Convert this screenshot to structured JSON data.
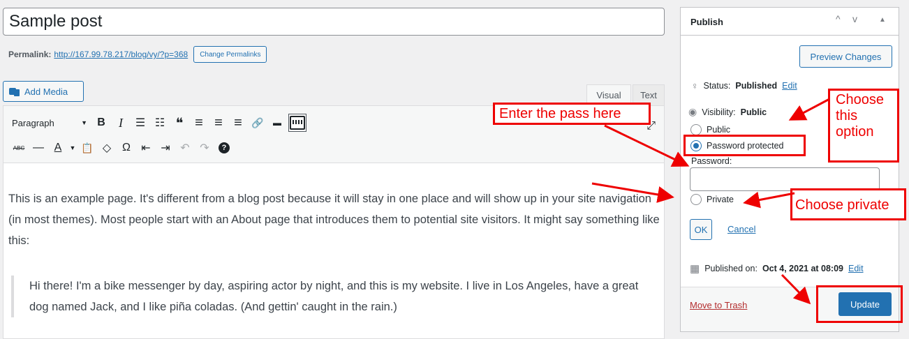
{
  "editor": {
    "title_value": "Sample post",
    "permalink_label": "Permalink:",
    "permalink_url": "http://167.99.78.217/blog/vy/?p=368",
    "change_permalinks_label": "Change Permalinks",
    "add_media_label": "Add Media",
    "tab_visual": "Visual",
    "tab_text": "Text",
    "format_select": "Paragraph",
    "content_paragraph": "This is an example page. It's different from a blog post because it will stay in one place and will show up in your site navigation (in most themes). Most people start with an About page that introduces them to potential site visitors. It might say something like this:",
    "content_quote": "Hi there! I'm a bike messenger by day, aspiring actor by night, and this is my website. I live in Los Angeles, have a great dog named Jack, and I like piña coladas. (And gettin' caught in the rain.)",
    "toolbar_row1_icons": [
      "bold-icon",
      "italic-icon",
      "bulleted-list-icon",
      "numbered-list-icon",
      "blockquote-icon",
      "align-left-icon",
      "align-center-icon",
      "align-right-icon",
      "link-icon",
      "read-more-icon",
      "toolbar-toggle-icon"
    ],
    "toolbar_row2_icons": [
      "strikethrough-icon",
      "horizontal-line-icon",
      "text-color-icon",
      "paste-text-icon",
      "clear-formatting-icon",
      "special-character-icon",
      "outdent-icon",
      "indent-icon",
      "undo-icon",
      "redo-icon",
      "help-icon"
    ],
    "glyphs": {
      "bold": "B",
      "italic": "I",
      "bullets": "☰",
      "numbers": "☷",
      "quote": "❝",
      "align_left": "≡",
      "align_center": "≡",
      "align_right": "≡",
      "link": "🔗",
      "more": "▬",
      "strike": "ABC",
      "hr": "—",
      "text_color": "A",
      "paste": "📋",
      "clear": "◇",
      "omega": "Ω",
      "outdent": "⇤",
      "indent": "⇥",
      "undo": "↶",
      "redo": "↷",
      "help": "?"
    }
  },
  "publish": {
    "title": "Publish",
    "header_controls": [
      "^",
      "v",
      "▲"
    ],
    "preview_label": "Preview Changes",
    "status_label": "Status:",
    "status_value": "Published",
    "edit_label": "Edit",
    "visibility_label": "Visibility:",
    "visibility_value": "Public",
    "options": [
      {
        "label": "Public",
        "checked": false
      },
      {
        "label": "Password protected",
        "checked": true
      },
      {
        "label": "Private",
        "checked": false
      }
    ],
    "password_label": "Password:",
    "ok_label": "OK",
    "cancel_label": "Cancel",
    "published_on_label": "Published on:",
    "published_on_value": "Oct 4, 2021 at 08:09",
    "published_edit_label": "Edit",
    "trash_label": "Move to Trash",
    "update_label": "Update"
  },
  "annotations": {
    "enter_pass": "Enter the pass here",
    "choose_option": "Choose this option",
    "choose_private": "Choose private",
    "color": "#e00000"
  },
  "colors": {
    "accent": "#2271b1",
    "trash": "#b32d2e",
    "annotation": "#e00000"
  }
}
